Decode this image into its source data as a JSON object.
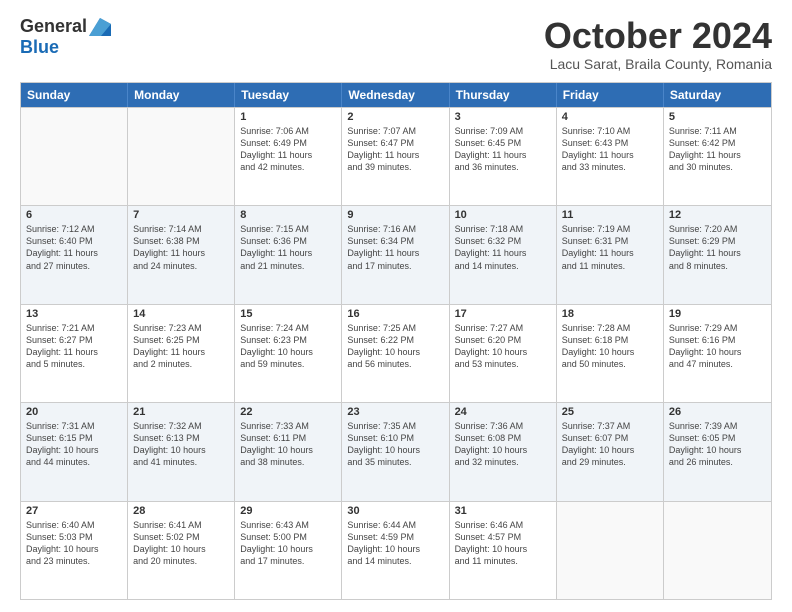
{
  "logo": {
    "general": "General",
    "blue": "Blue"
  },
  "title": "October 2024",
  "subtitle": "Lacu Sarat, Braila County, Romania",
  "header_days": [
    "Sunday",
    "Monday",
    "Tuesday",
    "Wednesday",
    "Thursday",
    "Friday",
    "Saturday"
  ],
  "rows": [
    [
      {
        "day": "",
        "lines": [],
        "empty": true
      },
      {
        "day": "",
        "lines": [],
        "empty": true
      },
      {
        "day": "1",
        "lines": [
          "Sunrise: 7:06 AM",
          "Sunset: 6:49 PM",
          "Daylight: 11 hours",
          "and 42 minutes."
        ]
      },
      {
        "day": "2",
        "lines": [
          "Sunrise: 7:07 AM",
          "Sunset: 6:47 PM",
          "Daylight: 11 hours",
          "and 39 minutes."
        ]
      },
      {
        "day": "3",
        "lines": [
          "Sunrise: 7:09 AM",
          "Sunset: 6:45 PM",
          "Daylight: 11 hours",
          "and 36 minutes."
        ]
      },
      {
        "day": "4",
        "lines": [
          "Sunrise: 7:10 AM",
          "Sunset: 6:43 PM",
          "Daylight: 11 hours",
          "and 33 minutes."
        ]
      },
      {
        "day": "5",
        "lines": [
          "Sunrise: 7:11 AM",
          "Sunset: 6:42 PM",
          "Daylight: 11 hours",
          "and 30 minutes."
        ]
      }
    ],
    [
      {
        "day": "6",
        "lines": [
          "Sunrise: 7:12 AM",
          "Sunset: 6:40 PM",
          "Daylight: 11 hours",
          "and 27 minutes."
        ]
      },
      {
        "day": "7",
        "lines": [
          "Sunrise: 7:14 AM",
          "Sunset: 6:38 PM",
          "Daylight: 11 hours",
          "and 24 minutes."
        ]
      },
      {
        "day": "8",
        "lines": [
          "Sunrise: 7:15 AM",
          "Sunset: 6:36 PM",
          "Daylight: 11 hours",
          "and 21 minutes."
        ]
      },
      {
        "day": "9",
        "lines": [
          "Sunrise: 7:16 AM",
          "Sunset: 6:34 PM",
          "Daylight: 11 hours",
          "and 17 minutes."
        ]
      },
      {
        "day": "10",
        "lines": [
          "Sunrise: 7:18 AM",
          "Sunset: 6:32 PM",
          "Daylight: 11 hours",
          "and 14 minutes."
        ]
      },
      {
        "day": "11",
        "lines": [
          "Sunrise: 7:19 AM",
          "Sunset: 6:31 PM",
          "Daylight: 11 hours",
          "and 11 minutes."
        ]
      },
      {
        "day": "12",
        "lines": [
          "Sunrise: 7:20 AM",
          "Sunset: 6:29 PM",
          "Daylight: 11 hours",
          "and 8 minutes."
        ]
      }
    ],
    [
      {
        "day": "13",
        "lines": [
          "Sunrise: 7:21 AM",
          "Sunset: 6:27 PM",
          "Daylight: 11 hours",
          "and 5 minutes."
        ]
      },
      {
        "day": "14",
        "lines": [
          "Sunrise: 7:23 AM",
          "Sunset: 6:25 PM",
          "Daylight: 11 hours",
          "and 2 minutes."
        ]
      },
      {
        "day": "15",
        "lines": [
          "Sunrise: 7:24 AM",
          "Sunset: 6:23 PM",
          "Daylight: 10 hours",
          "and 59 minutes."
        ]
      },
      {
        "day": "16",
        "lines": [
          "Sunrise: 7:25 AM",
          "Sunset: 6:22 PM",
          "Daylight: 10 hours",
          "and 56 minutes."
        ]
      },
      {
        "day": "17",
        "lines": [
          "Sunrise: 7:27 AM",
          "Sunset: 6:20 PM",
          "Daylight: 10 hours",
          "and 53 minutes."
        ]
      },
      {
        "day": "18",
        "lines": [
          "Sunrise: 7:28 AM",
          "Sunset: 6:18 PM",
          "Daylight: 10 hours",
          "and 50 minutes."
        ]
      },
      {
        "day": "19",
        "lines": [
          "Sunrise: 7:29 AM",
          "Sunset: 6:16 PM",
          "Daylight: 10 hours",
          "and 47 minutes."
        ]
      }
    ],
    [
      {
        "day": "20",
        "lines": [
          "Sunrise: 7:31 AM",
          "Sunset: 6:15 PM",
          "Daylight: 10 hours",
          "and 44 minutes."
        ]
      },
      {
        "day": "21",
        "lines": [
          "Sunrise: 7:32 AM",
          "Sunset: 6:13 PM",
          "Daylight: 10 hours",
          "and 41 minutes."
        ]
      },
      {
        "day": "22",
        "lines": [
          "Sunrise: 7:33 AM",
          "Sunset: 6:11 PM",
          "Daylight: 10 hours",
          "and 38 minutes."
        ]
      },
      {
        "day": "23",
        "lines": [
          "Sunrise: 7:35 AM",
          "Sunset: 6:10 PM",
          "Daylight: 10 hours",
          "and 35 minutes."
        ]
      },
      {
        "day": "24",
        "lines": [
          "Sunrise: 7:36 AM",
          "Sunset: 6:08 PM",
          "Daylight: 10 hours",
          "and 32 minutes."
        ]
      },
      {
        "day": "25",
        "lines": [
          "Sunrise: 7:37 AM",
          "Sunset: 6:07 PM",
          "Daylight: 10 hours",
          "and 29 minutes."
        ]
      },
      {
        "day": "26",
        "lines": [
          "Sunrise: 7:39 AM",
          "Sunset: 6:05 PM",
          "Daylight: 10 hours",
          "and 26 minutes."
        ]
      }
    ],
    [
      {
        "day": "27",
        "lines": [
          "Sunrise: 6:40 AM",
          "Sunset: 5:03 PM",
          "Daylight: 10 hours",
          "and 23 minutes."
        ]
      },
      {
        "day": "28",
        "lines": [
          "Sunrise: 6:41 AM",
          "Sunset: 5:02 PM",
          "Daylight: 10 hours",
          "and 20 minutes."
        ]
      },
      {
        "day": "29",
        "lines": [
          "Sunrise: 6:43 AM",
          "Sunset: 5:00 PM",
          "Daylight: 10 hours",
          "and 17 minutes."
        ]
      },
      {
        "day": "30",
        "lines": [
          "Sunrise: 6:44 AM",
          "Sunset: 4:59 PM",
          "Daylight: 10 hours",
          "and 14 minutes."
        ]
      },
      {
        "day": "31",
        "lines": [
          "Sunrise: 6:46 AM",
          "Sunset: 4:57 PM",
          "Daylight: 10 hours",
          "and 11 minutes."
        ]
      },
      {
        "day": "",
        "lines": [],
        "empty": true
      },
      {
        "day": "",
        "lines": [],
        "empty": true
      }
    ]
  ]
}
